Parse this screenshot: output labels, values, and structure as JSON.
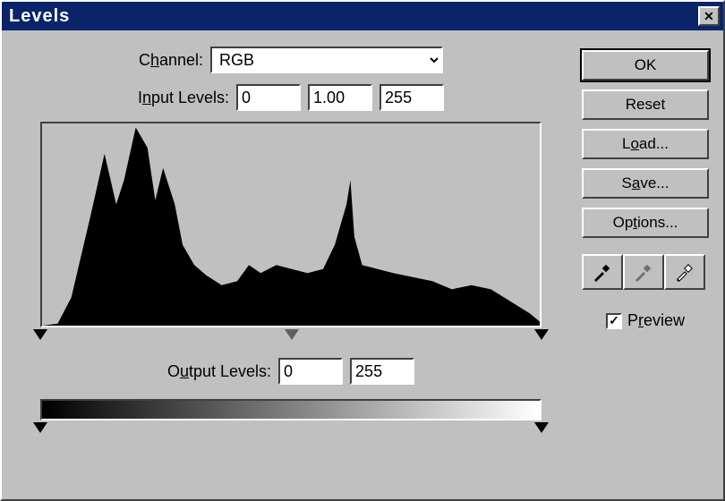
{
  "window": {
    "title": "Levels"
  },
  "channel": {
    "label_pre": "C",
    "label_u": "h",
    "label_post": "annel:",
    "value": "RGB"
  },
  "input_levels": {
    "label_pre": "I",
    "label_u": "n",
    "label_post": "put Levels:",
    "shadow": "0",
    "mid": "1.00",
    "highlight": "255"
  },
  "output_levels": {
    "label_pre": "O",
    "label_u": "u",
    "label_post": "tput Levels:",
    "low": "0",
    "high": "255"
  },
  "buttons": {
    "ok": "OK",
    "reset": "Reset",
    "load_pre": "L",
    "load_u": "o",
    "load_post": "ad...",
    "save_pre": "S",
    "save_u": "a",
    "save_post": "ve...",
    "options_pre": "Op",
    "options_u": "t",
    "options_post": "ions..."
  },
  "preview": {
    "checked": "✓",
    "label_pre": "P",
    "label_u": "r",
    "label_post": "eview"
  },
  "chart_data": {
    "type": "area",
    "title": "Histogram",
    "xlabel": "",
    "ylabel": "",
    "xlim": [
      0,
      255
    ],
    "ylim": [
      0,
      100
    ],
    "x": [
      0,
      8,
      15,
      25,
      32,
      38,
      42,
      48,
      54,
      58,
      62,
      68,
      72,
      78,
      84,
      92,
      100,
      106,
      112,
      120,
      128,
      136,
      144,
      150,
      156,
      158,
      160,
      164,
      172,
      180,
      190,
      200,
      210,
      220,
      230,
      240,
      250,
      255
    ],
    "values": [
      0,
      1,
      14,
      55,
      85,
      60,
      72,
      98,
      88,
      62,
      78,
      60,
      40,
      30,
      25,
      20,
      22,
      30,
      26,
      30,
      28,
      26,
      28,
      40,
      60,
      72,
      44,
      30,
      28,
      26,
      24,
      22,
      18,
      20,
      18,
      12,
      6,
      2
    ],
    "sliders": {
      "input_shadow": 0,
      "input_mid": 128,
      "input_highlight": 255,
      "output_low": 0,
      "output_high": 255
    }
  }
}
